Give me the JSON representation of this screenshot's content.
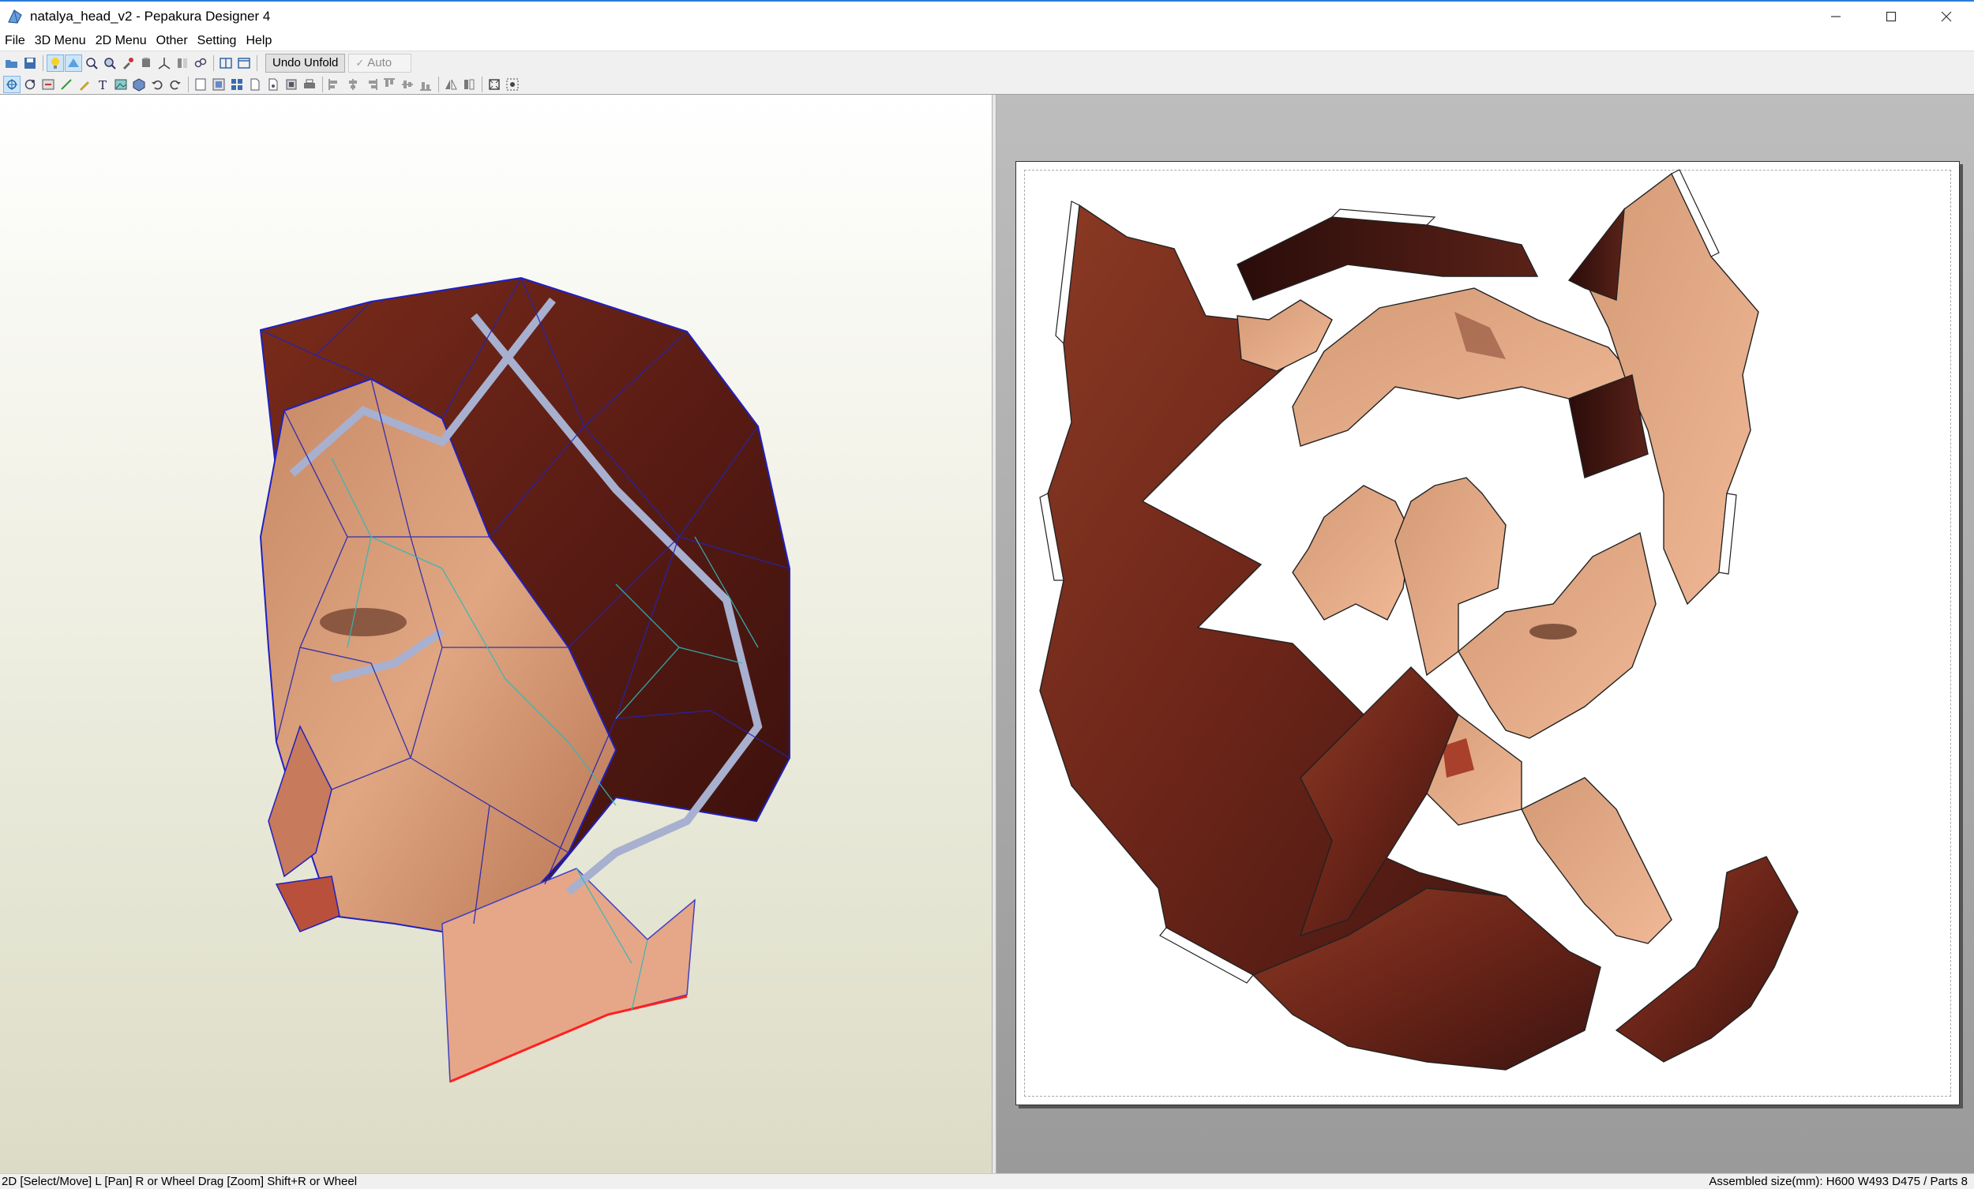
{
  "window": {
    "title": "natalya_head_v2 - Pepakura Designer 4",
    "icons": {
      "app": "pepakura-app-icon",
      "minimize": "minimize-icon",
      "maximize": "maximize-icon",
      "close": "close-icon"
    }
  },
  "menu": {
    "items": [
      "File",
      "3D Menu",
      "2D Menu",
      "Other",
      "Setting",
      "Help"
    ]
  },
  "toolbar": {
    "undo_unfold_label": "Undo Unfold",
    "auto_label": "Auto",
    "auto_checked": true
  },
  "view3d": {
    "cut_line_color": "#ff2020",
    "edge_color_mountain": "#2020c0",
    "edge_color_valley": "#40c0c0"
  },
  "status": {
    "left": "2D [Select/Move] L [Pan] R or Wheel Drag [Zoom] Shift+R or Wheel",
    "right": "Assembled size(mm): H600 W493 D475 / Parts 8"
  }
}
